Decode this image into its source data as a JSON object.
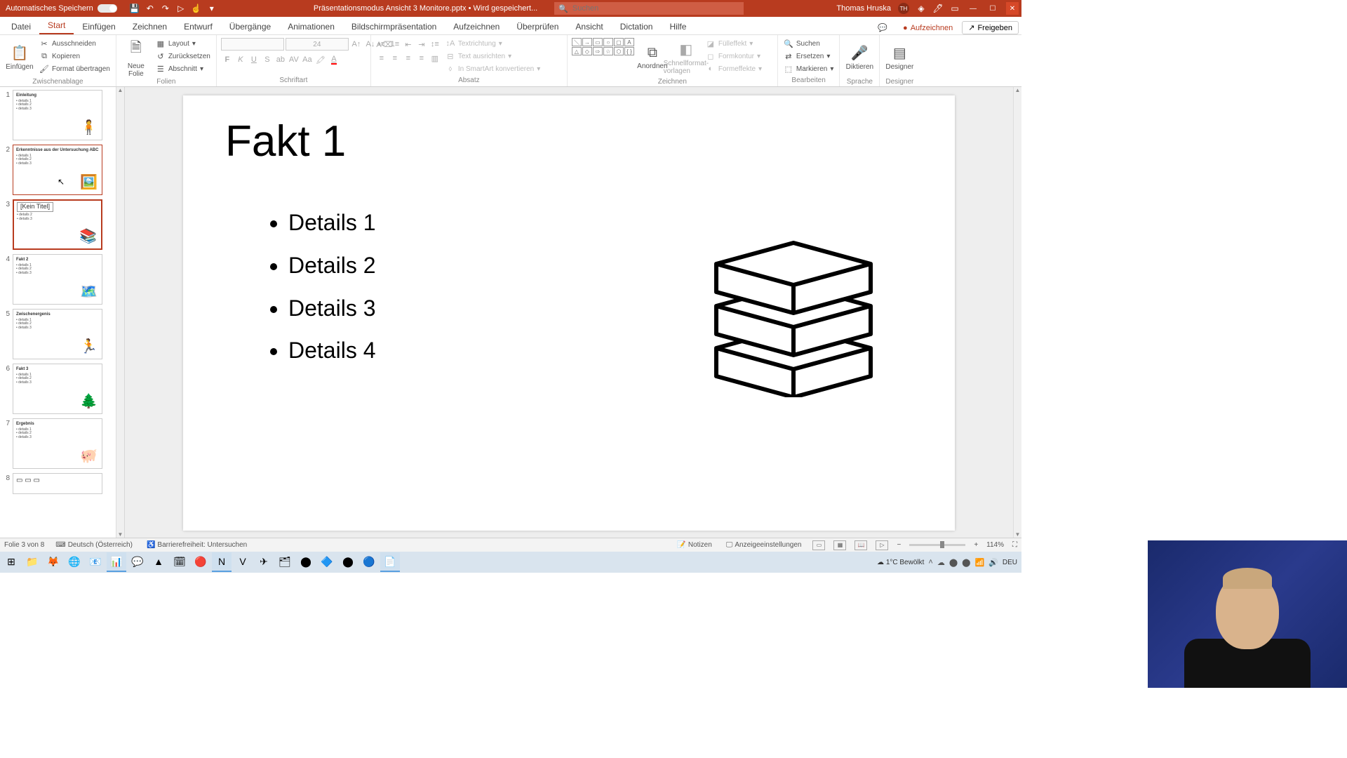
{
  "titlebar": {
    "autosave_label": "Automatisches Speichern",
    "doc_title": "Präsentationsmodus Ansicht 3 Monitore.pptx • Wird gespeichert...",
    "search_placeholder": "Suchen",
    "user_name": "Thomas Hruska",
    "user_initials": "TH"
  },
  "ribbon_tabs": [
    "Datei",
    "Start",
    "Einfügen",
    "Zeichnen",
    "Entwurf",
    "Übergänge",
    "Animationen",
    "Bildschirmpräsentation",
    "Aufzeichnen",
    "Überprüfen",
    "Ansicht",
    "Dictation",
    "Hilfe"
  ],
  "ribbon_tabs_active_index": 1,
  "ribbon_right": {
    "record": "Aufzeichnen",
    "share": "Freigeben"
  },
  "ribbon_groups": {
    "clipboard": {
      "title": "Zwischenablage",
      "paste": "Einfügen",
      "cut": "Ausschneiden",
      "copy": "Kopieren",
      "format_painter": "Format übertragen"
    },
    "slides": {
      "title": "Folien",
      "new_slide": "Neue\nFolie",
      "layout": "Layout",
      "reset": "Zurücksetzen",
      "section": "Abschnitt"
    },
    "font": {
      "title": "Schriftart",
      "size": "24"
    },
    "paragraph": {
      "title": "Absatz",
      "text_direction": "Textrichtung",
      "align_text": "Text ausrichten",
      "smartart": "In SmartArt konvertieren"
    },
    "drawing": {
      "title": "Zeichnen",
      "arrange": "Anordnen",
      "quickstyles": "Schnellformat-\nvorlagen",
      "fill": "Fülleffekt",
      "outline": "Formkontur",
      "effects": "Formeffekte"
    },
    "editing": {
      "title": "Bearbeiten",
      "find": "Suchen",
      "replace": "Ersetzen",
      "select": "Markieren"
    },
    "voice": {
      "title": "Sprache",
      "dictate": "Diktieren"
    },
    "designer": {
      "title": "Designer",
      "designer": "Designer"
    }
  },
  "thumbnails": [
    {
      "num": 1,
      "title": "Einleitung",
      "graphic": "🧍"
    },
    {
      "num": 2,
      "title": "Erkenntnisse aus der Untersuchung ABC",
      "graphic": "🖼️"
    },
    {
      "num": 3,
      "title": "Fakt 1",
      "graphic": "📚",
      "tooltip": "[Kein Titel]"
    },
    {
      "num": 4,
      "title": "Fakt 2",
      "graphic": "🗺️"
    },
    {
      "num": 5,
      "title": "Zwischenergenis",
      "graphic": "🏃"
    },
    {
      "num": 6,
      "title": "Fakt 3",
      "graphic": "🌲"
    },
    {
      "num": 7,
      "title": "Ergebnis",
      "graphic": "🐖"
    },
    {
      "num": 8,
      "title": "",
      "graphic": ""
    }
  ],
  "thumbnails_selected": 3,
  "thumbnails_hover": 2,
  "slide": {
    "title": "Fakt 1",
    "bullets": [
      "Details 1",
      "Details 2",
      "Details 3",
      "Details 4"
    ]
  },
  "statusbar": {
    "slide_pos": "Folie 3 von 8",
    "language": "Deutsch (Österreich)",
    "accessibility": "Barrierefreiheit: Untersuchen",
    "notes": "Notizen",
    "display_settings": "Anzeigeeinstellungen",
    "zoom": "114%"
  },
  "taskbar": {
    "weather": "1°C  Bewölkt",
    "lang": "DEU"
  }
}
